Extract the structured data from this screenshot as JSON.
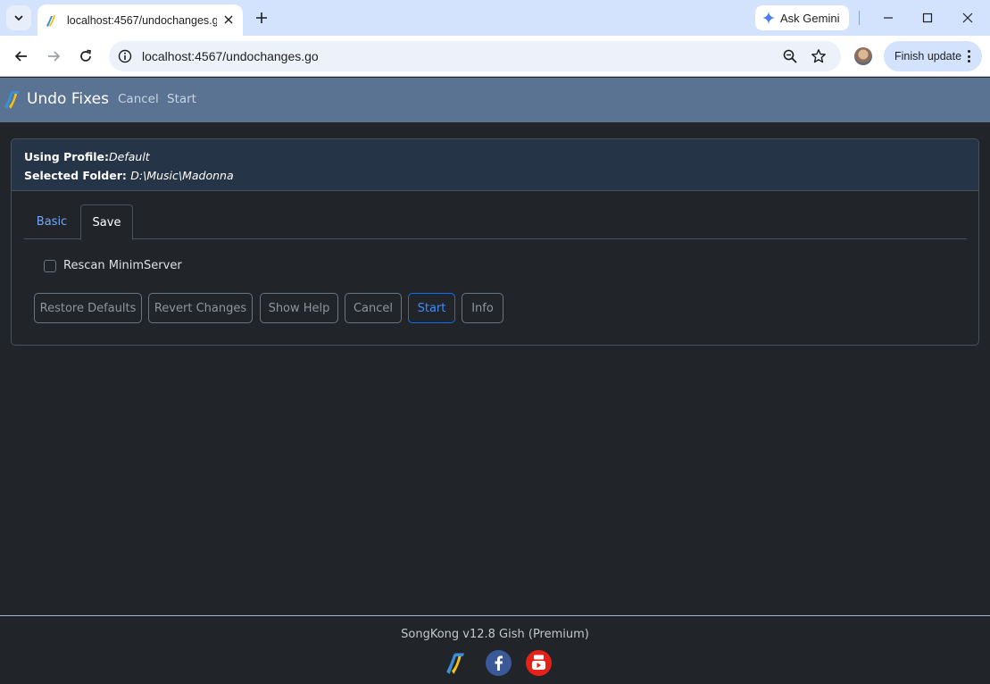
{
  "browser": {
    "tab_title": "localhost:4567/undochanges.go",
    "url": "localhost:4567/undochanges.go",
    "gemini_label": "Ask Gemini",
    "finish_update_label": "Finish update"
  },
  "app": {
    "brand_title": "Undo Fixes",
    "nav": {
      "cancel": "Cancel",
      "start": "Start"
    }
  },
  "card": {
    "profile_label": "Using Profile:",
    "profile_value": "Default",
    "folder_label": "Selected Folder: ",
    "folder_value": "D:\\Music\\Madonna",
    "tabs": {
      "basic": "Basic",
      "save": "Save"
    },
    "checkbox_label": "Rescan MinimServer",
    "buttons": {
      "restore_defaults": "Restore Defaults",
      "revert_changes": "Revert Changes",
      "show_help": "Show Help",
      "cancel": "Cancel",
      "start": "Start",
      "info": "Info"
    }
  },
  "footer": {
    "version_text": "SongKong v12.8 Gish (Premium)"
  },
  "colors": {
    "navbar": "#5b7393",
    "card_header": "#263447",
    "primary": "#0d6efd",
    "page_bg": "#212529"
  }
}
